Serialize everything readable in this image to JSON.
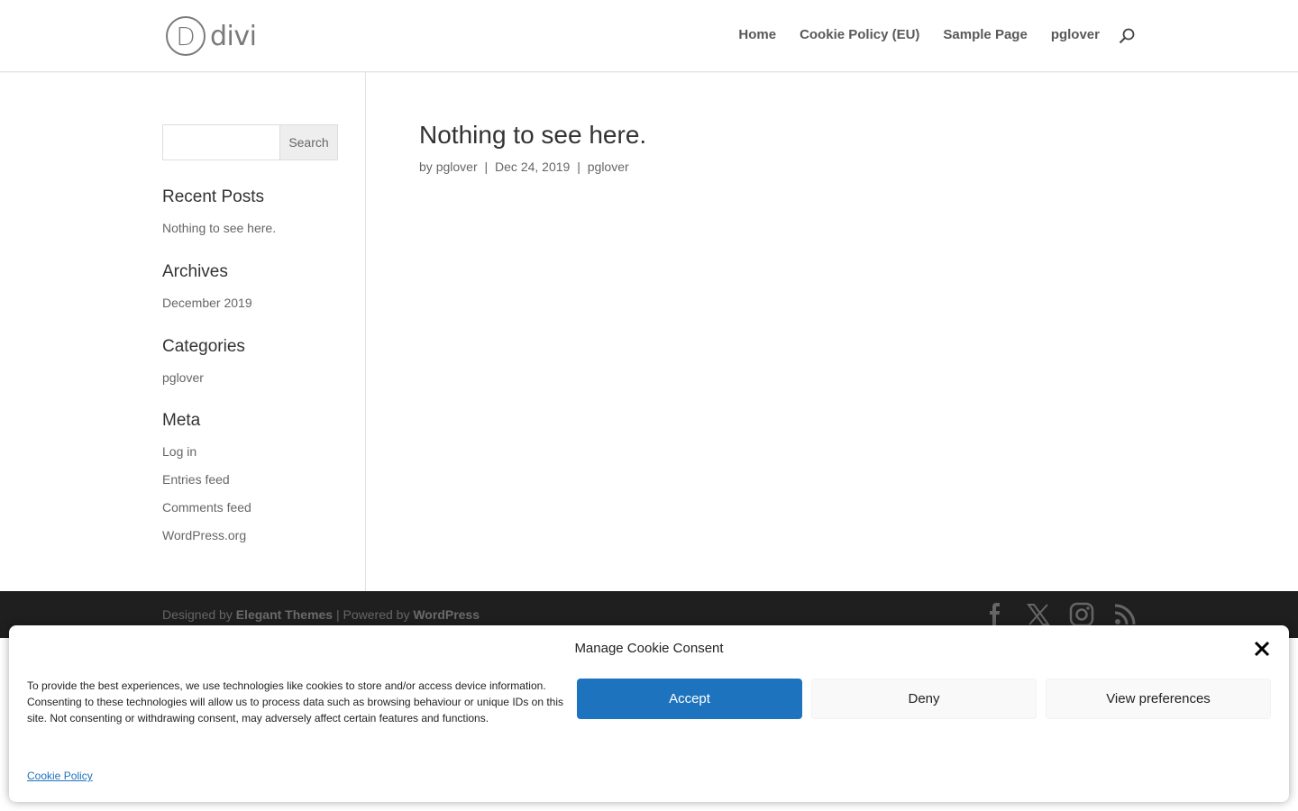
{
  "header": {
    "logo_text": "divi",
    "logo_letter": "D",
    "nav": [
      "Home",
      "Cookie Policy (EU)",
      "Sample Page",
      "pglover"
    ]
  },
  "sidebar": {
    "search_placeholder": "",
    "search_button": "Search",
    "recent_posts_title": "Recent Posts",
    "recent_posts": [
      "Nothing to see here."
    ],
    "archives_title": "Archives",
    "archives": [
      "December 2019"
    ],
    "categories_title": "Categories",
    "categories": [
      "pglover"
    ],
    "meta_title": "Meta",
    "meta": [
      "Log in",
      "Entries feed",
      "Comments feed",
      "WordPress.org"
    ]
  },
  "post": {
    "title": "Nothing to see here.",
    "by": "by",
    "author": "pglover",
    "sep": "|",
    "date": "Dec 24, 2019",
    "category": "pglover"
  },
  "footer": {
    "designed_by": "Designed by",
    "elegant": "Elegant Themes",
    "powered": "| Powered by",
    "wordpress": "WordPress",
    "social": [
      "facebook-icon",
      "x-icon",
      "instagram-icon",
      "rss-icon"
    ]
  },
  "cookie": {
    "title": "Manage Cookie Consent",
    "text": "To provide the best experiences, we use technologies like cookies to store and/or access device information. Consenting to these technologies will allow us to process data such as browsing behaviour or unique IDs on this site. Not consenting or withdrawing consent, may adversely affect certain features and functions.",
    "accept": "Accept",
    "deny": "Deny",
    "preferences": "View preferences",
    "policy_link": "Cookie Policy"
  },
  "colors": {
    "accent": "#1e73be",
    "footer_bg": "#1f1f1f"
  }
}
